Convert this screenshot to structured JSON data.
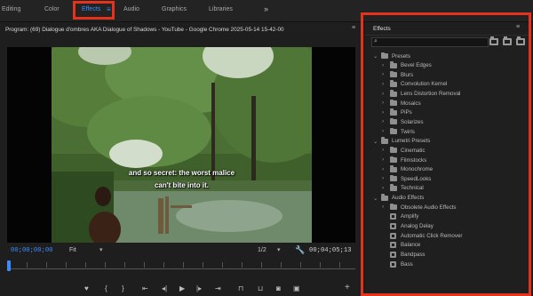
{
  "workspaces": {
    "tabs": [
      {
        "label": "Editing"
      },
      {
        "label": "Color"
      },
      {
        "label": "Effects"
      },
      {
        "label": "Audio"
      },
      {
        "label": "Graphics"
      },
      {
        "label": "Libraries"
      }
    ],
    "active": "Effects",
    "menu_glyph": "≡",
    "more_glyph": "»"
  },
  "program": {
    "title": "Program: (69) Dialogue d'ombres AKA Dialogue of Shadows - YouTube - Google Chrome 2025-05-14 15-42-00",
    "menu_glyph": "≡",
    "subtitle_line1": "and so secret: the worst malice",
    "subtitle_line2": "can't bite into it.",
    "timecode_current": "00;00;00;00",
    "zoom": "Fit",
    "resolution": "1/2",
    "timecode_duration": "00;04;05;13",
    "playhead_fraction": 0.0
  },
  "effects": {
    "title": "Effects",
    "menu_glyph": "≡",
    "search_placeholder": "",
    "items": [
      {
        "label": "Presets",
        "level": 0,
        "kind": "folder",
        "expanded": true
      },
      {
        "label": "Bevel Edges",
        "level": 1,
        "kind": "folder"
      },
      {
        "label": "Blurs",
        "level": 1,
        "kind": "folder"
      },
      {
        "label": "Convolution Kernel",
        "level": 1,
        "kind": "folder"
      },
      {
        "label": "Lens Distortion Removal",
        "level": 1,
        "kind": "folder"
      },
      {
        "label": "Mosaics",
        "level": 1,
        "kind": "folder"
      },
      {
        "label": "PiPs",
        "level": 1,
        "kind": "folder"
      },
      {
        "label": "Solarizes",
        "level": 1,
        "kind": "folder"
      },
      {
        "label": "Twirls",
        "level": 1,
        "kind": "folder"
      },
      {
        "label": "Lumetri Presets",
        "level": 0,
        "kind": "folder",
        "expanded": true
      },
      {
        "label": "Cinematic",
        "level": 1,
        "kind": "folder"
      },
      {
        "label": "Filmstocks",
        "level": 1,
        "kind": "folder"
      },
      {
        "label": "Monochrome",
        "level": 1,
        "kind": "folder"
      },
      {
        "label": "SpeedLooks",
        "level": 1,
        "kind": "folder"
      },
      {
        "label": "Technical",
        "level": 1,
        "kind": "folder"
      },
      {
        "label": "Audio Effects",
        "level": 0,
        "kind": "folder",
        "expanded": true
      },
      {
        "label": "Obsolete Audio Effects",
        "level": 1,
        "kind": "folder"
      },
      {
        "label": "Amplify",
        "level": 1,
        "kind": "effect"
      },
      {
        "label": "Analog Delay",
        "level": 1,
        "kind": "effect"
      },
      {
        "label": "Automatic Click Remover",
        "level": 1,
        "kind": "effect"
      },
      {
        "label": "Balance",
        "level": 1,
        "kind": "effect"
      },
      {
        "label": "Bandpass",
        "level": 1,
        "kind": "effect"
      },
      {
        "label": "Bass",
        "level": 1,
        "kind": "effect"
      }
    ]
  },
  "colors": {
    "accent": "#3c8cff",
    "highlight_box": "#e3331c"
  }
}
